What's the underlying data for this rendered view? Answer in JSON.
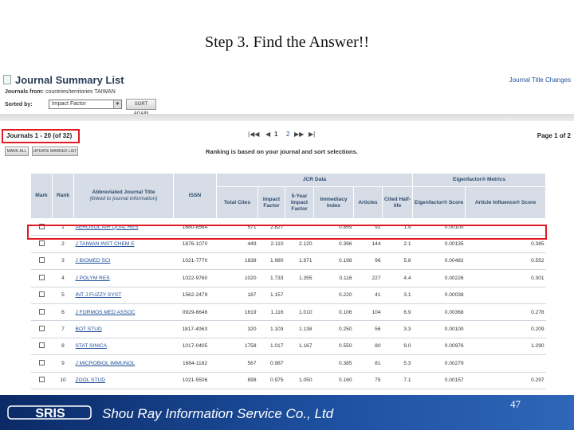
{
  "slide": {
    "title": "Step 3. Find the Answer!!",
    "page_number": "47"
  },
  "jcr": {
    "header_title": "Journal Summary List",
    "title_changes_link": "Journal Title Changes",
    "journals_from_label": "Journals from:",
    "journals_from_value": "countries/territories TAIWAN",
    "sorted_by_label": "Sorted by:",
    "sort_value": "Impact Factor",
    "sort_again_button": "SORT AGAIN",
    "journals_count": "Journals 1 - 20 (of 32)",
    "pager_current": "1",
    "pager_next": "2",
    "page_of": "Page 1 of 2",
    "mark_all_button": "MARK ALL",
    "update_marked_button": "UPDATE MARKED LIST",
    "ranking_note": "Ranking is based on your journal and sort selections.",
    "groups": {
      "jcr_data": "JCR Data",
      "eigenfactor": "Eigenfactor® Metrics"
    },
    "columns": {
      "mark": "Mark",
      "rank": "Rank",
      "title": "Abbreviated Journal Title",
      "title_sub": "(linked to journal information)",
      "issn": "ISSN",
      "total_cites": "Total Cites",
      "impact_factor": "Impact Factor",
      "five_year": "5-Year Impact Factor",
      "immediacy": "Immediacy Index",
      "articles": "Articles",
      "half_life": "Cited Half-life",
      "eigen_score": "Eigenfactor® Score",
      "influence_score": "Article Influence® Score"
    },
    "rows": [
      {
        "rank": "1",
        "title": "AEROSOL AIR QUAL RES",
        "issn": "1680-8584",
        "total_cites": "571",
        "impact_factor": "2.827",
        "five_year": "",
        "immediacy": "0.859",
        "articles": "92",
        "half_life": "1.9",
        "eigen": "0.00100",
        "influence": ""
      },
      {
        "rank": "2",
        "title": "J TAIWAN INST CHEM E",
        "issn": "1876-1070",
        "total_cites": "449",
        "impact_factor": "2.110",
        "five_year": "2.120",
        "immediacy": "0.396",
        "articles": "144",
        "half_life": "2.1",
        "eigen": "0.00135",
        "influence": "0.385"
      },
      {
        "rank": "3",
        "title": "J BIOMED SCI",
        "issn": "1021-7770",
        "total_cites": "1838",
        "impact_factor": "1.980",
        "five_year": "1.971",
        "immediacy": "0.198",
        "articles": "96",
        "half_life": "5.8",
        "eigen": "0.00482",
        "influence": "0.552"
      },
      {
        "rank": "4",
        "title": "J POLYM RES",
        "issn": "1022-9760",
        "total_cites": "1020",
        "impact_factor": "1.733",
        "five_year": "1.355",
        "immediacy": "0.116",
        "articles": "227",
        "half_life": "4.4",
        "eigen": "0.00226",
        "influence": "0.301"
      },
      {
        "rank": "5",
        "title": "INT J FUZZY SYST",
        "issn": "1562-2479",
        "total_cites": "187",
        "impact_factor": "1.157",
        "five_year": "",
        "immediacy": "0.220",
        "articles": "41",
        "half_life": "3.1",
        "eigen": "0.00038",
        "influence": ""
      },
      {
        "rank": "6",
        "title": "J FORMOS MED ASSOC",
        "issn": "0929-6646",
        "total_cites": "1619",
        "impact_factor": "1.116",
        "five_year": "1.010",
        "immediacy": "0.106",
        "articles": "104",
        "half_life": "6.9",
        "eigen": "0.00368",
        "influence": "0.278"
      },
      {
        "rank": "7",
        "title": "BOT STUD",
        "issn": "1817-406X",
        "total_cites": "320",
        "impact_factor": "1.103",
        "five_year": "1.138",
        "immediacy": "0.250",
        "articles": "56",
        "half_life": "3.3",
        "eigen": "0.00100",
        "influence": "0.209"
      },
      {
        "rank": "8",
        "title": "STAT SINICA",
        "issn": "1017-0405",
        "total_cites": "1758",
        "impact_factor": "1.017",
        "five_year": "1.167",
        "immediacy": "0.550",
        "articles": "80",
        "half_life": "9.0",
        "eigen": "0.00976",
        "influence": "1.290"
      },
      {
        "rank": "9",
        "title": "J MICROBIOL IMMUNOL",
        "issn": "1684-1182",
        "total_cites": "567",
        "impact_factor": "0.987",
        "five_year": "",
        "immediacy": "0.385",
        "articles": "81",
        "half_life": "5.3",
        "eigen": "0.00279",
        "influence": ""
      },
      {
        "rank": "10",
        "title": "ZOOL STUD",
        "issn": "1021-5506",
        "total_cites": "898",
        "impact_factor": "0.975",
        "five_year": "1.050",
        "immediacy": "0.160",
        "articles": "75",
        "half_life": "7.1",
        "eigen": "0.00157",
        "influence": "0.297"
      }
    ]
  },
  "footer": {
    "company": "Shou Ray Information Service Co., Ltd",
    "logo_text": "SRIS"
  },
  "colors": {
    "highlight_red": "#e21b23",
    "footer_blue": "#1d4f9f",
    "header_blue": "#d6dde6"
  }
}
